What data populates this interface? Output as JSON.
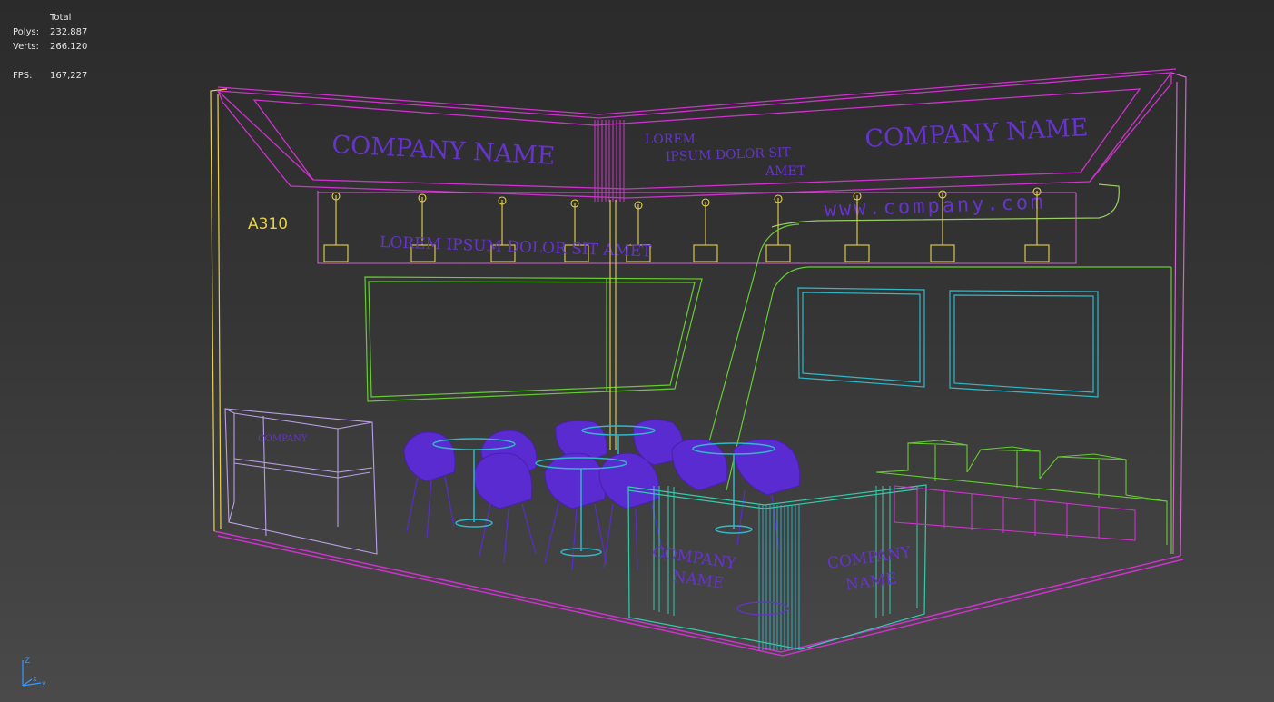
{
  "viewport": {
    "background_top": "#2b2b2b",
    "background_bottom": "#4a4a4a"
  },
  "stats": {
    "header": "Total",
    "polys_label": "Polys:",
    "polys_value": "232.887",
    "verts_label": "Verts:",
    "verts_value": "266.120",
    "fps_label": "FPS:",
    "fps_value": "167,227"
  },
  "booth": {
    "id_label": "A310",
    "header_left": "COMPANY NAME",
    "header_right": "COMPANY NAME",
    "header_mid_line1": "LOREM",
    "header_mid_line2": "IPSUM DOLOR SIT",
    "header_mid_line3": "AMET",
    "website": "www.company.com",
    "tagline": "LOREM IPSUM DOLOR SIT AMET",
    "counter_left_line1": "COMPANY",
    "counter_left_line2": "NAME",
    "counter_right_line1": "COMPANY",
    "counter_right_line2": "NAME",
    "colors": {
      "frame": "#cc33cc",
      "text": "#6633cc",
      "yellow": "#e6d24d",
      "green": "#66cc33",
      "cyan": "#2fb8c8",
      "teal": "#33ccaa",
      "chair": "#5a2bd1"
    }
  },
  "axis_gizmo": {
    "z_label": "Z",
    "x_label": "x",
    "y_label": "y",
    "color": "#3399ff"
  }
}
